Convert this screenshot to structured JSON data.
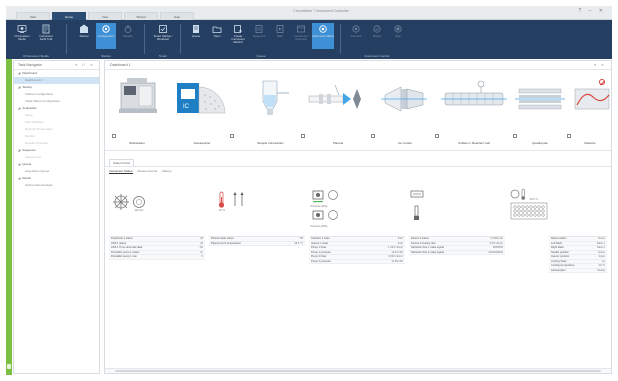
{
  "titlebar": {
    "title": "Chromeleon 7 Instrument Controller",
    "window_controls": "? – ✕",
    "tabs": [
      {
        "label": "Start"
      },
      {
        "label": "Home"
      },
      {
        "label": "View"
      },
      {
        "label": "Wizard"
      },
      {
        "label": "Help"
      }
    ]
  },
  "ribbon": {
    "groups": [
      {
        "label": "Chromeleon Studio",
        "buttons": [
          {
            "label": "Chromeleon Studio",
            "icon": "studio-icon"
          },
          {
            "label": "Instrument Audit Trail",
            "icon": "audit-icon"
          }
        ]
      },
      {
        "label": "Startup",
        "buttons": [
          {
            "label": "Startup",
            "icon": "startup-icon"
          },
          {
            "label": "Configuration",
            "icon": "configuration-icon"
          },
          {
            "label": "Standby",
            "icon": "standby-icon"
          }
        ]
      },
      {
        "label": "Smart",
        "buttons": [
          {
            "label": "Smart Startup / Shutdown",
            "icon": "smart-startup-icon"
          }
        ]
      },
      {
        "label": "Queue",
        "buttons": [
          {
            "label": "Queue",
            "icon": "queue-icon"
          },
          {
            "label": "Open",
            "icon": "open-icon"
          },
          {
            "label": "Create Instrument Method",
            "icon": "create-method-icon"
          },
          {
            "label": "Sequence",
            "icon": "sequence-icon"
          },
          {
            "label": "Start",
            "icon": "start-icon"
          },
          {
            "label": "Instrument Overview",
            "icon": "overview-icon"
          },
          {
            "label": "Instrument Status",
            "icon": "status-icon"
          }
        ]
      },
      {
        "label": "Instrument Control",
        "buttons": [
          {
            "label": "Connect",
            "icon": "connect-icon"
          },
          {
            "label": "Ready",
            "icon": "ready-icon"
          },
          {
            "label": "Stop",
            "icon": "stop-icon"
          }
        ]
      }
    ]
  },
  "navigator": {
    "title": "Task Navigator",
    "controls": "▾ ⊓ ✕",
    "items": [
      {
        "label": "Dashboard",
        "level": 0
      },
      {
        "label": "Dashboard 1",
        "level": 1,
        "selected": true
      },
      {
        "label": "Startup",
        "level": 0
      },
      {
        "label": "Startup Configuration",
        "level": 1
      },
      {
        "label": "Initial Status Configuration",
        "level": 1
      },
      {
        "label": "Acquisition",
        "level": 0
      },
      {
        "label": "Setup",
        "level": 1,
        "disabled": true
      },
      {
        "label": "Flow Modules",
        "level": 1,
        "disabled": true
      },
      {
        "label": "Detector Parameters",
        "level": 1,
        "disabled": true
      },
      {
        "label": "Monitor",
        "level": 1,
        "disabled": true
      },
      {
        "label": "Results Overview",
        "level": 1,
        "disabled": true
      },
      {
        "label": "Sequence",
        "level": 0
      },
      {
        "label": "Sample List",
        "level": 1,
        "disabled": true
      },
      {
        "label": "Queue",
        "level": 0
      },
      {
        "label": "Acquisition Queue",
        "level": 1
      },
      {
        "label": "Result",
        "level": 0
      },
      {
        "label": "Online Data Analysis",
        "level": 1
      }
    ]
  },
  "main": {
    "title": "Dashboard 1",
    "controls": "▾ ✕",
    "modules": [
      {
        "label": "Workstation",
        "icon": "workstation-icon"
      },
      {
        "label": "Autosampler",
        "icon": "autosampler-icon"
      },
      {
        "label": "Sample Introduction",
        "icon": "sample-introduction-icon"
      },
      {
        "label": "Plasma",
        "icon": "plasma-icon"
      },
      {
        "label": "Ion Cooler",
        "icon": "ion-cooler-icon"
      },
      {
        "label": "Collision / Reaction Cell",
        "icon": "reaction-cell-icon"
      },
      {
        "label": "Quadrupole",
        "icon": "quadrupole-icon"
      },
      {
        "label": "Detector",
        "icon": "detector-icon"
      }
    ],
    "lower_tab": "Status Panel",
    "subtabs": [
      {
        "label": "Instrument Status"
      },
      {
        "label": "Device Control"
      },
      {
        "label": "History"
      }
    ],
    "cards": [
      {
        "caption": "100 rpm",
        "stats": [
          {
            "label": "Peripheral 1 status",
            "value": "off"
          },
          {
            "label": "ASX-1 status",
            "value": "off"
          },
          {
            "label": "ASX-1 Time since last data",
            "value": "1/5"
          },
          {
            "label": "Peristaltic pump 1 status",
            "value": "on"
          },
          {
            "label": "Peristaltic pump 1 rate",
            "value": "0"
          }
        ]
      },
      {
        "caption": "20 °C",
        "stats": [
          {
            "label": "Plasma state status",
            "value": "Off"
          },
          {
            "label": "Plasma torch temperature",
            "value": "28.6 °C"
          }
        ]
      },
      {
        "caption_top": "Pressure (kPa)",
        "caption_bottom": "Pressure (kPa)",
        "stats": [
          {
            "label": "Interface 1 state",
            "value": "Inert"
          },
          {
            "label": "Injector 1 state",
            "value": "Inert"
          },
          {
            "label": "Pump 1 Flow",
            "value": "1.000 ml/min"
          },
          {
            "label": "Pump 1 pressure",
            "value": "10.42 kPa"
          },
          {
            "label": "Pump 2 Flow",
            "value": "0.000 ml/min"
          },
          {
            "label": "Pump 2 pressure",
            "value": "11.86 kPa"
          }
        ]
      },
      {
        "caption": "",
        "stats": [
          {
            "label": "Device 2 status",
            "value": "0.0000 bar"
          },
          {
            "label": "Device 2 heating rate",
            "value": "0.00 ml/min"
          },
          {
            "label": "Nebulizer flow 1 value signal",
            "value": "0000000"
          },
          {
            "label": "Nebulizer flow 2 value signal",
            "value": "0000000000"
          }
        ]
      },
      {
        "caption": "20.0 °C",
        "stats": [
          {
            "label": "Rack position",
            "value": "Home"
          },
          {
            "label": "Left Rack",
            "value": "Rack 1"
          },
          {
            "label": "Right Rack",
            "value": "Rack 2"
          },
          {
            "label": "Needle position",
            "value": "Home"
          },
          {
            "label": "Injector position",
            "value": "Inject"
          },
          {
            "label": "Cooling State",
            "value": "on"
          },
          {
            "label": "Cooling temperature",
            "value": "20 °C"
          },
          {
            "label": "Autosampler",
            "value": "Ready"
          }
        ]
      }
    ]
  },
  "colors": {
    "ribbon": "#243f61",
    "ribbon_selected": "#3d8fd6",
    "green_strip": "#7bc043",
    "selection": "#cfe3f5",
    "alert": "#e03a3a"
  }
}
